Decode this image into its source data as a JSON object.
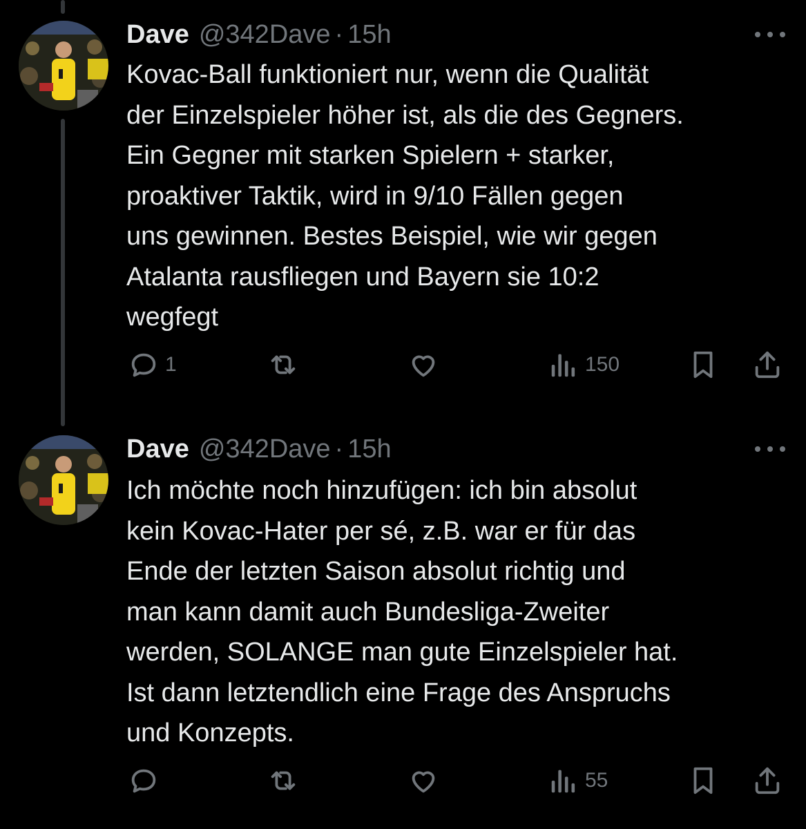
{
  "thread": {
    "tweets": [
      {
        "author": {
          "name": "Dave",
          "handle": "@342Dave",
          "separator": "·",
          "time": "15h",
          "avatar": "avatar-photo-player-yellow-jersey"
        },
        "text": "Kovac-Ball funktioniert nur, wenn die Qualität\nder Einzelspieler höher ist, als die des Gegners.\nEin Gegner mit starken Spielern + starker,\nproaktiver Taktik, wird in 9/10 Fällen gegen\nuns gewinnen. Bestes Beispiel, wie wir gegen\nAtalanta rausfliegen und Bayern sie 10:2\nwegfegt",
        "stats": {
          "replies": "1",
          "reposts": "",
          "likes": "",
          "views": "150"
        },
        "icons": {
          "reply": "reply-icon",
          "repost": "repost-icon",
          "like": "heart-icon",
          "views": "views-icon",
          "bookmark": "bookmark-icon",
          "share": "share-icon",
          "more": "more-icon"
        }
      },
      {
        "author": {
          "name": "Dave",
          "handle": "@342Dave",
          "separator": "·",
          "time": "15h",
          "avatar": "avatar-photo-player-yellow-jersey"
        },
        "text": "Ich möchte noch hinzufügen: ich bin absolut\nkein Kovac-Hater per sé, z.B. war er für das\nEnde der letzten Saison absolut richtig und\nman kann damit auch Bundesliga-Zweiter\nwerden, SOLANGE man gute Einzelspieler hat.\nIst dann letztendlich eine Frage des Anspruchs\nund Konzepts.",
        "stats": {
          "replies": "",
          "reposts": "",
          "likes": "",
          "views": "55"
        },
        "icons": {
          "reply": "reply-icon",
          "repost": "repost-icon",
          "like": "heart-icon",
          "views": "views-icon",
          "bookmark": "bookmark-icon",
          "share": "share-icon",
          "more": "more-icon"
        }
      }
    ]
  },
  "colors": {
    "background": "#000000",
    "primary_text": "#e7e9ea",
    "secondary_text": "#71767b",
    "thread_line": "#333639"
  }
}
